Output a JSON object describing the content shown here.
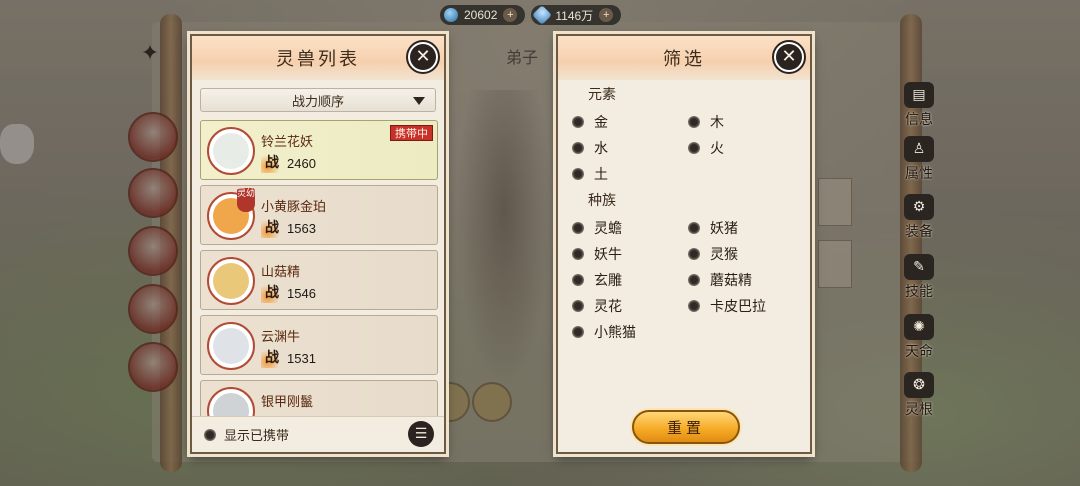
{
  "currency": [
    {
      "icon": "water-drop-icon",
      "value": "20602",
      "plus": "+"
    },
    {
      "icon": "gem-icon",
      "value": "1146万",
      "plus": "+"
    }
  ],
  "background": {
    "center_label": "弟子"
  },
  "pet_panel": {
    "title": "灵兽列表",
    "close": "✕",
    "sort_label": "战力顺序",
    "power_char": "战",
    "pets": [
      {
        "name": "铃兰花妖",
        "power": "2460",
        "badge": "携带中",
        "lock": "",
        "avatar_color": "#e7ece6",
        "ring": "#b24a34",
        "selected": true
      },
      {
        "name": "小黄豚金珀",
        "power": "1563",
        "badge": "",
        "lock": "灵幼",
        "avatar_color": "#f0a64a",
        "ring": "#b24a34",
        "selected": false
      },
      {
        "name": "山菇精",
        "power": "1546",
        "badge": "",
        "lock": "",
        "avatar_color": "#e9c87a",
        "ring": "#b24a34",
        "selected": false
      },
      {
        "name": "云渊牛",
        "power": "1531",
        "badge": "",
        "lock": "",
        "avatar_color": "#dfe3e8",
        "ring": "#b24a34",
        "selected": false
      },
      {
        "name": "银甲刚鬣",
        "power": "",
        "badge": "",
        "lock": "",
        "avatar_color": "#cfd3d6",
        "ring": "#b24a34",
        "selected": false
      }
    ],
    "footer_label": "显示已携带",
    "list_icon": "☰"
  },
  "filter_panel": {
    "title": "筛选",
    "close": "✕",
    "element_title": "元素",
    "elements": [
      "金",
      "木",
      "水",
      "火",
      "土"
    ],
    "race_title": "种族",
    "races": [
      "灵蟾",
      "妖猪",
      "妖牛",
      "灵猴",
      "玄雕",
      "蘑菇精",
      "灵花",
      "卡皮巴拉",
      "小熊猫"
    ],
    "reset_label": "重置"
  },
  "side_tabs": [
    {
      "label": "信息",
      "icon": "info-book-icon",
      "glyph": "▤"
    },
    {
      "label": "属性",
      "icon": "attribute-figure-icon",
      "glyph": "♙"
    },
    {
      "label": "装备",
      "icon": "equipment-bag-icon",
      "glyph": "⚙"
    },
    {
      "label": "技能",
      "icon": "skill-book-icon",
      "glyph": "✎"
    },
    {
      "label": "天命",
      "icon": "destiny-icon",
      "glyph": "✺"
    },
    {
      "label": "灵根",
      "icon": "spirit-root-icon",
      "glyph": "❂"
    }
  ]
}
